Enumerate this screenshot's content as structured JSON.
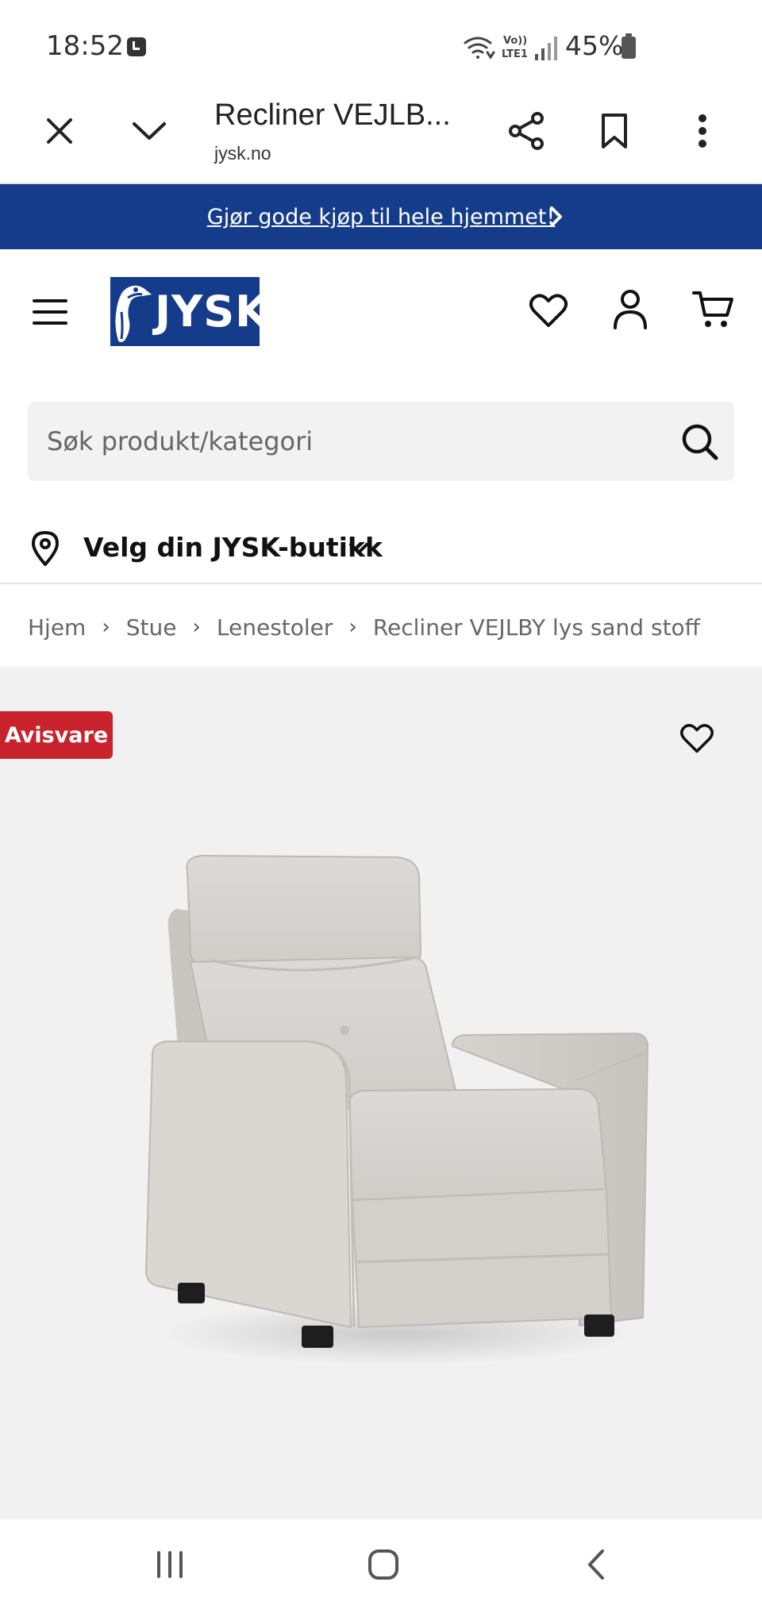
{
  "status_bar": {
    "time": "18:52",
    "battery": "45%",
    "icons": [
      "alarm-icon",
      "wifi-calling-icon",
      "volte-icon",
      "signal-icon",
      "battery-icon"
    ],
    "volte_top": "Vo))",
    "volte_bottom": "LTE1"
  },
  "browser": {
    "title": "Recliner VEJLB...",
    "url": "jysk.no",
    "icons": [
      "close-icon",
      "chevron-down-icon",
      "share-icon",
      "bookmark-icon",
      "more-vertical-icon"
    ]
  },
  "promo": {
    "text": "Gjør gode kjøp til hele hjemmet!",
    "background": "#143c8a"
  },
  "header": {
    "logo_text": "JYSK",
    "brand_color": "#143c8a",
    "icons": [
      "hamburger-menu-icon",
      "heart-icon",
      "user-icon",
      "cart-icon"
    ]
  },
  "search": {
    "placeholder": "Søk produkt/kategori"
  },
  "store": {
    "label": "Velg din JYSK-butikk"
  },
  "breadcrumb": {
    "items": [
      "Hjem",
      "Stue",
      "Lenestoler",
      "Recliner VEJLBY lys sand stoff"
    ]
  },
  "product": {
    "badge": "Avisvare",
    "badge_color": "#c8232c",
    "image": "light sand fabric recliner chair"
  },
  "nav_bar": {
    "icons": [
      "recent-apps-icon",
      "home-icon",
      "back-icon"
    ]
  }
}
